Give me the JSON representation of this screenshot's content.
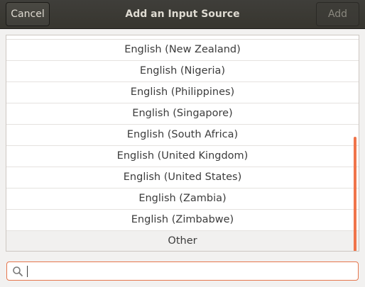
{
  "dialog": {
    "title": "Add an Input Source",
    "cancel_label": "Cancel",
    "add_label": "Add"
  },
  "list": {
    "items": [
      "English (New Zealand)",
      "English (Nigeria)",
      "English (Philippines)",
      "English (Singapore)",
      "English (South Africa)",
      "English (United Kingdom)",
      "English (United States)",
      "English (Zambia)",
      "English (Zimbabwe)"
    ],
    "other_label": "Other"
  },
  "search": {
    "value": "",
    "icon": "search-icon"
  },
  "colors": {
    "headerbar": "#3c3b37",
    "accent": "#f0744a"
  }
}
